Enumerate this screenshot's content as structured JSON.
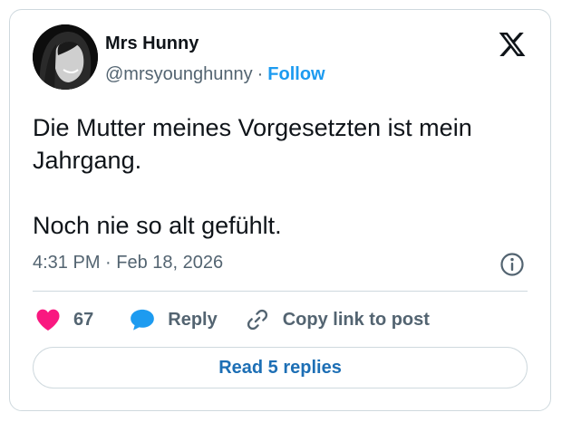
{
  "author": {
    "display_name": "Mrs Hunny",
    "handle": "@mrsyounghunny",
    "separator": "·",
    "follow_label": "Follow"
  },
  "tweet": {
    "lines": [
      "Die Mutter meines Vorgesetzten ist mein Jahrgang.",
      "Noch nie so alt gefühlt."
    ],
    "timestamp": "4:31 PM · Feb 18, 2026"
  },
  "actions": {
    "like_count": "67",
    "reply_label": "Reply",
    "copy_link_label": "Copy link to post"
  },
  "read_replies_label": "Read 5 replies",
  "icons": {
    "brand": "x-logo-icon",
    "info": "info-icon",
    "like": "heart-icon",
    "reply": "speech-bubble-icon",
    "copy": "link-icon"
  },
  "colors": {
    "like": "#f91880",
    "reply": "#1d9bf0",
    "follow": "#1d9bf0",
    "read_replies": "#1d6fb5",
    "muted": "#536471"
  }
}
